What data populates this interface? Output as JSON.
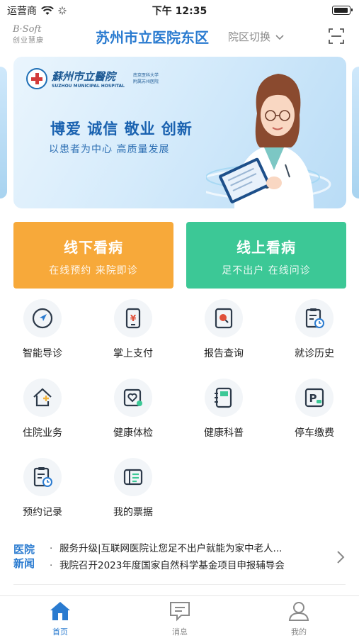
{
  "statusbar": {
    "carrier": "运营商",
    "time": "下午 12:35"
  },
  "header": {
    "logo_top": "B·Soft",
    "logo_bottom": "创业慧康",
    "hospital_name": "苏州市立医院东区",
    "switch_label": "院区切换",
    "scan_icon": "scan-icon"
  },
  "banner": {
    "logo_cn": "蘇州市立醫院",
    "logo_en": "SUZHOU MUNICIPAL HOSPITAL",
    "logo_side_1": "南京医科大学",
    "logo_side_2": "附属苏州医院",
    "slogan": "博爱 诚信 敬业 创新",
    "subslogan": "以患者为中心  高质量发展"
  },
  "cards": {
    "offline": {
      "title": "线下看病",
      "subtitle": "在线预约  来院即诊",
      "color": "#f7a93a"
    },
    "online": {
      "title": "线上看病",
      "subtitle": "足不出户  在线问诊",
      "color": "#3cc896"
    }
  },
  "grid": [
    {
      "label": "智能导诊",
      "icon": "compass-icon"
    },
    {
      "label": "掌上支付",
      "icon": "payment-icon"
    },
    {
      "label": "报告查询",
      "icon": "report-search-icon"
    },
    {
      "label": "就诊历史",
      "icon": "history-icon"
    },
    {
      "label": "住院业务",
      "icon": "inpatient-icon"
    },
    {
      "label": "健康体检",
      "icon": "checkup-icon"
    },
    {
      "label": "健康科普",
      "icon": "health-book-icon"
    },
    {
      "label": "停车缴费",
      "icon": "parking-icon"
    },
    {
      "label": "预约记录",
      "icon": "appointment-record-icon"
    },
    {
      "label": "我的票据",
      "icon": "receipt-icon"
    }
  ],
  "news": {
    "tag": "医院新闻",
    "items": [
      "服务升级|互联网医院让您足不出户就能为家中老人...",
      "我院召开2023年度国家自然科学基金项目申报辅导会"
    ]
  },
  "tabbar": [
    {
      "label": "首页",
      "active": true
    },
    {
      "label": "消息",
      "active": false
    },
    {
      "label": "我的",
      "active": false
    }
  ],
  "colors": {
    "brand_blue": "#2a7bd0",
    "orange": "#f7a93a",
    "green": "#3cc896"
  }
}
